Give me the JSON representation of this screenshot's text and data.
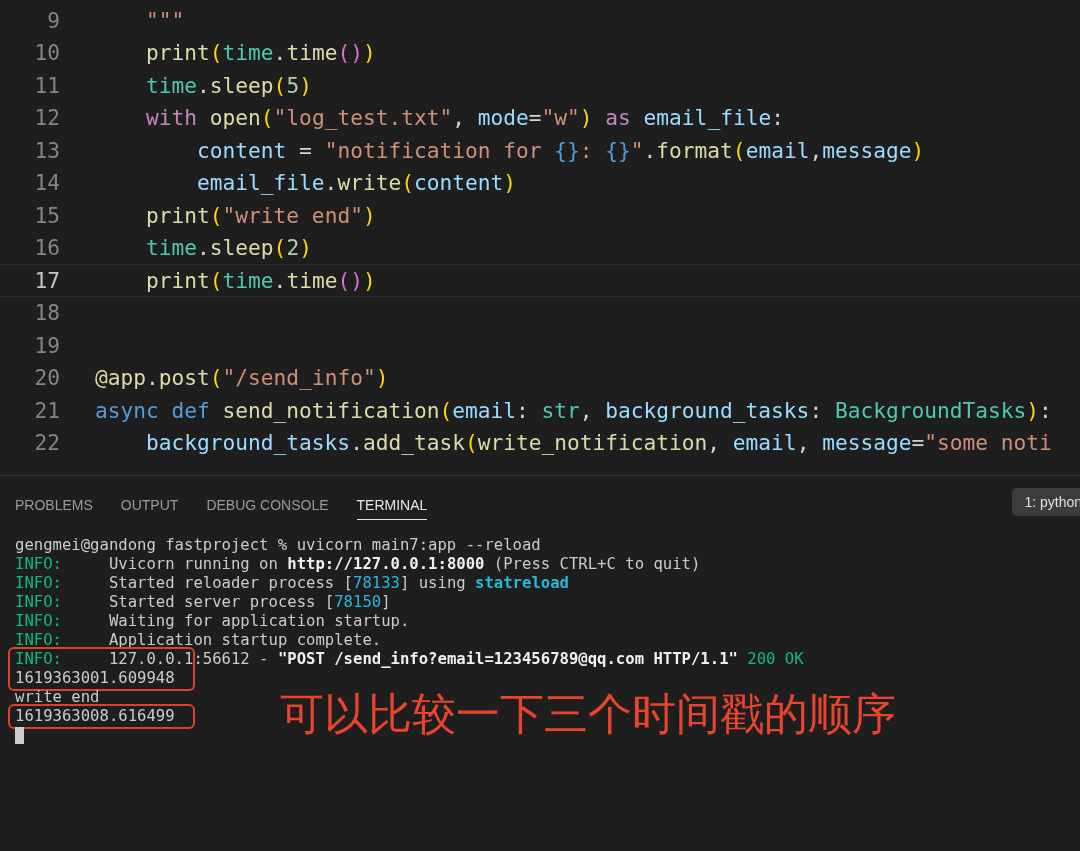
{
  "editor": {
    "lines": [
      {
        "number": "9",
        "current": false,
        "tokens": [
          {
            "text": "    \"\"\"",
            "kind": "str"
          }
        ]
      },
      {
        "number": "10",
        "current": false,
        "tokens": [
          {
            "text": "    print",
            "kind": "fn"
          },
          {
            "text": "(",
            "kind": "br1"
          },
          {
            "text": "time",
            "kind": "cls"
          },
          {
            "text": ".",
            "kind": "plain"
          },
          {
            "text": "time",
            "kind": "fn"
          },
          {
            "text": "()",
            "kind": "br2"
          },
          {
            "text": ")",
            "kind": "br1"
          }
        ]
      },
      {
        "number": "11",
        "current": false,
        "tokens": [
          {
            "text": "    time",
            "kind": "cls"
          },
          {
            "text": ".",
            "kind": "plain"
          },
          {
            "text": "sleep",
            "kind": "fn"
          },
          {
            "text": "(",
            "kind": "br1"
          },
          {
            "text": "5",
            "kind": "num"
          },
          {
            "text": ")",
            "kind": "br1"
          }
        ]
      },
      {
        "number": "12",
        "current": false,
        "tokens": [
          {
            "text": "    with",
            "kind": "kw"
          },
          {
            "text": " open",
            "kind": "fn"
          },
          {
            "text": "(",
            "kind": "br1"
          },
          {
            "text": "\"log_test.txt\"",
            "kind": "str"
          },
          {
            "text": ", ",
            "kind": "plain"
          },
          {
            "text": "mode",
            "kind": "var"
          },
          {
            "text": "=",
            "kind": "plain"
          },
          {
            "text": "\"w\"",
            "kind": "str"
          },
          {
            "text": ")",
            "kind": "br1"
          },
          {
            "text": " as",
            "kind": "kw"
          },
          {
            "text": " email_file",
            "kind": "var"
          },
          {
            "text": ":",
            "kind": "plain"
          }
        ]
      },
      {
        "number": "13",
        "current": false,
        "tokens": [
          {
            "text": "        content",
            "kind": "var"
          },
          {
            "text": " = ",
            "kind": "plain"
          },
          {
            "text": "\"notification for ",
            "kind": "str"
          },
          {
            "text": "{}",
            "kind": "brace"
          },
          {
            "text": ": ",
            "kind": "str"
          },
          {
            "text": "{}",
            "kind": "brace"
          },
          {
            "text": "\"",
            "kind": "str"
          },
          {
            "text": ".",
            "kind": "plain"
          },
          {
            "text": "format",
            "kind": "fn"
          },
          {
            "text": "(",
            "kind": "br1"
          },
          {
            "text": "email",
            "kind": "var"
          },
          {
            "text": ",",
            "kind": "plain"
          },
          {
            "text": "message",
            "kind": "var"
          },
          {
            "text": ")",
            "kind": "br1"
          }
        ]
      },
      {
        "number": "14",
        "current": false,
        "tokens": [
          {
            "text": "        email_file",
            "kind": "var"
          },
          {
            "text": ".",
            "kind": "plain"
          },
          {
            "text": "write",
            "kind": "fn"
          },
          {
            "text": "(",
            "kind": "br1"
          },
          {
            "text": "content",
            "kind": "var"
          },
          {
            "text": ")",
            "kind": "br1"
          }
        ]
      },
      {
        "number": "15",
        "current": false,
        "tokens": [
          {
            "text": "    print",
            "kind": "fn"
          },
          {
            "text": "(",
            "kind": "br1"
          },
          {
            "text": "\"write end\"",
            "kind": "str"
          },
          {
            "text": ")",
            "kind": "br1"
          }
        ]
      },
      {
        "number": "16",
        "current": false,
        "tokens": [
          {
            "text": "    time",
            "kind": "cls"
          },
          {
            "text": ".",
            "kind": "plain"
          },
          {
            "text": "sleep",
            "kind": "fn"
          },
          {
            "text": "(",
            "kind": "br1"
          },
          {
            "text": "2",
            "kind": "num"
          },
          {
            "text": ")",
            "kind": "br1"
          }
        ]
      },
      {
        "number": "17",
        "current": true,
        "tokens": [
          {
            "text": "    print",
            "kind": "fn"
          },
          {
            "text": "(",
            "kind": "br1"
          },
          {
            "text": "time",
            "kind": "cls"
          },
          {
            "text": ".",
            "kind": "plain"
          },
          {
            "text": "time",
            "kind": "fn"
          },
          {
            "text": "()",
            "kind": "br2"
          },
          {
            "text": ")",
            "kind": "br1"
          }
        ]
      },
      {
        "number": "18",
        "current": false
      },
      {
        "number": "19",
        "current": false
      },
      {
        "number": "20",
        "current": false,
        "tokens": [
          {
            "text": "@app",
            "kind": "fn"
          },
          {
            "text": ".",
            "kind": "plain"
          },
          {
            "text": "post",
            "kind": "fn"
          },
          {
            "text": "(",
            "kind": "br1"
          },
          {
            "text": "\"/send_info\"",
            "kind": "str"
          },
          {
            "text": ")",
            "kind": "br1"
          }
        ]
      },
      {
        "number": "21",
        "current": false,
        "tokens": [
          {
            "text": "async def",
            "kind": "storage"
          },
          {
            "text": " send_notification",
            "kind": "fn"
          },
          {
            "text": "(",
            "kind": "br1"
          },
          {
            "text": "email",
            "kind": "var"
          },
          {
            "text": ": ",
            "kind": "plain"
          },
          {
            "text": "str",
            "kind": "cls"
          },
          {
            "text": ", ",
            "kind": "plain"
          },
          {
            "text": "background_tasks",
            "kind": "var"
          },
          {
            "text": ": ",
            "kind": "plain"
          },
          {
            "text": "BackgroundTasks",
            "kind": "cls"
          },
          {
            "text": ")",
            "kind": "br1"
          },
          {
            "text": ":",
            "kind": "plain"
          }
        ]
      },
      {
        "number": "22",
        "current": false,
        "tokens": [
          {
            "text": "    background_tasks",
            "kind": "var"
          },
          {
            "text": ".",
            "kind": "plain"
          },
          {
            "text": "add_task",
            "kind": "fn"
          },
          {
            "text": "(",
            "kind": "br1"
          },
          {
            "text": "write_notification",
            "kind": "fn"
          },
          {
            "text": ", ",
            "kind": "plain"
          },
          {
            "text": "email",
            "kind": "var"
          },
          {
            "text": ", ",
            "kind": "plain"
          },
          {
            "text": "message",
            "kind": "var"
          },
          {
            "text": "=",
            "kind": "plain"
          },
          {
            "text": "\"some noti",
            "kind": "str"
          }
        ]
      }
    ]
  },
  "panel": {
    "tabs": [
      {
        "label": "PROBLEMS",
        "selected": false
      },
      {
        "label": "OUTPUT",
        "selected": false
      },
      {
        "label": "DEBUG CONSOLE",
        "selected": false
      },
      {
        "label": "TERMINAL",
        "selected": true
      }
    ],
    "terminal_selector": "1: python",
    "terminal": {
      "lines": [
        {
          "boxed": false,
          "segments": [
            {
              "text": "gengmei@gandong fastproject % uvicorn main7:app --reload",
              "kind": "plain"
            }
          ]
        },
        {
          "boxed": false,
          "segments": [
            {
              "text": "INFO:",
              "kind": "info"
            },
            {
              "text": "     Uvicorn running on ",
              "kind": "plain"
            },
            {
              "text": "http://127.0.0.1:8000",
              "kind": "bold"
            },
            {
              "text": " (Press CTRL+C to quit)",
              "kind": "plain"
            }
          ]
        },
        {
          "boxed": false,
          "segments": [
            {
              "text": "INFO:",
              "kind": "info"
            },
            {
              "text": "     Started reloader process [",
              "kind": "plain"
            },
            {
              "text": "78133",
              "kind": "num"
            },
            {
              "text": "] using ",
              "kind": "plain"
            },
            {
              "text": "statreload",
              "kind": "cyanbold"
            }
          ]
        },
        {
          "boxed": false,
          "segments": [
            {
              "text": "INFO:",
              "kind": "info"
            },
            {
              "text": "     Started server process [",
              "kind": "plain"
            },
            {
              "text": "78150",
              "kind": "num"
            },
            {
              "text": "]",
              "kind": "plain"
            }
          ]
        },
        {
          "boxed": false,
          "segments": [
            {
              "text": "INFO:",
              "kind": "info"
            },
            {
              "text": "     Waiting for application startup.",
              "kind": "plain"
            }
          ]
        },
        {
          "boxed": false,
          "segments": [
            {
              "text": "INFO:",
              "kind": "info"
            },
            {
              "text": "     Application startup complete.",
              "kind": "plain"
            }
          ]
        },
        {
          "boxed": true,
          "segments": [
            {
              "text": "INFO:",
              "kind": "info"
            },
            {
              "text": "     127.0.0.1:56612 - ",
              "kind": "plain"
            },
            {
              "text": "\"POST /send_info?email=123456789@qq.com HTTP/1.1\"",
              "kind": "bold"
            },
            {
              "text": " 200 OK",
              "kind": "green"
            }
          ]
        },
        {
          "boxed": true,
          "segments": [
            {
              "text": "1619363001.609948",
              "kind": "plain"
            }
          ]
        },
        {
          "boxed": false,
          "segments": [
            {
              "text": "write end",
              "kind": "plain"
            }
          ]
        },
        {
          "boxed": true,
          "segments": [
            {
              "text": "1619363008.616499",
              "kind": "plain"
            }
          ]
        }
      ]
    },
    "annotation": "可以比较一下三个时间戳的顺序"
  }
}
